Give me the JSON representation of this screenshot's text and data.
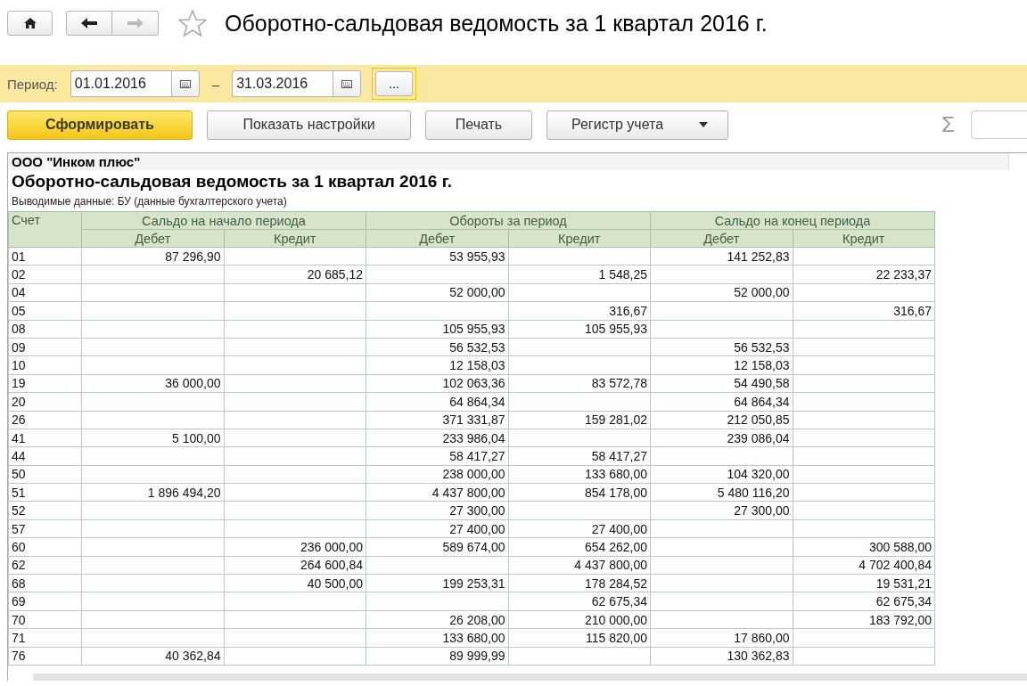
{
  "nav": {
    "back_disabled": false,
    "forward_disabled": true,
    "favorite": false
  },
  "window": {
    "title": "Оборотно-сальдовая ведомость за 1 квартал 2016 г."
  },
  "period": {
    "label": "Период:",
    "from": "01.01.2016",
    "separator": "–",
    "to": "31.03.2016",
    "more_button": "..."
  },
  "toolbar": {
    "buttons": [
      {
        "label": "Сформировать",
        "kind": "primary"
      },
      {
        "label": "Показать настройки",
        "kind": "plain"
      },
      {
        "label": "Печать",
        "kind": "plain"
      },
      {
        "label": "Регистр учета",
        "kind": "dropdown"
      }
    ],
    "sum_symbol": "Σ"
  },
  "report": {
    "organization": "ООО \"Инком плюс\"",
    "title": "Оборотно-сальдовая ведомость за 1 квартал 2016 г.",
    "subtitle": "Выводимые данные:  БУ (данные бухгалтерского учета)",
    "table": {
      "account_header": "Счет",
      "groups": [
        {
          "label": "Сальдо на начало периода",
          "debit": "Дебет",
          "credit": "Кредит"
        },
        {
          "label": "Обороты за период",
          "debit": "Дебет",
          "credit": "Кредит"
        },
        {
          "label": "Сальдо на конец периода",
          "debit": "Дебет",
          "credit": "Кредит"
        }
      ],
      "rows": [
        [
          "01",
          "87 296,90",
          null,
          "53 955,93",
          null,
          "141 252,83",
          null
        ],
        [
          "02",
          null,
          "20 685,12",
          null,
          "1 548,25",
          null,
          "22 233,37"
        ],
        [
          "04",
          null,
          null,
          "52 000,00",
          null,
          "52 000,00",
          null
        ],
        [
          "05",
          null,
          null,
          null,
          "316,67",
          null,
          "316,67"
        ],
        [
          "08",
          null,
          null,
          "105 955,93",
          "105 955,93",
          null,
          null
        ],
        [
          "09",
          null,
          null,
          "56 532,53",
          null,
          "56 532,53",
          null
        ],
        [
          "10",
          null,
          null,
          "12 158,03",
          null,
          "12 158,03",
          null
        ],
        [
          "19",
          "36 000,00",
          null,
          "102 063,36",
          "83 572,78",
          "54 490,58",
          null
        ],
        [
          "20",
          null,
          null,
          "64 864,34",
          null,
          "64 864,34",
          null
        ],
        [
          "26",
          null,
          null,
          "371 331,87",
          "159 281,02",
          "212 050,85",
          null
        ],
        [
          "41",
          "5 100,00",
          null,
          "233 986,04",
          null,
          "239 086,04",
          null
        ],
        [
          "44",
          null,
          null,
          "58 417,27",
          "58 417,27",
          null,
          null
        ],
        [
          "50",
          null,
          null,
          "238 000,00",
          "133 680,00",
          "104 320,00",
          null
        ],
        [
          "51",
          "1 896 494,20",
          null,
          "4 437 800,00",
          "854 178,00",
          "5 480 116,20",
          null
        ],
        [
          "52",
          null,
          null,
          "27 300,00",
          null,
          "27 300,00",
          null
        ],
        [
          "57",
          null,
          null,
          "27 400,00",
          "27 400,00",
          null,
          null
        ],
        [
          "60",
          null,
          "236 000,00",
          "589 674,00",
          "654 262,00",
          null,
          "300 588,00"
        ],
        [
          "62",
          null,
          "264 600,84",
          null,
          "4 437 800,00",
          null,
          "4 702 400,84"
        ],
        [
          "68",
          null,
          "40 500,00",
          "199 253,31",
          "178 284,52",
          null,
          "19 531,21"
        ],
        [
          "69",
          null,
          null,
          null,
          "62 675,34",
          null,
          "62 675,34"
        ],
        [
          "70",
          null,
          null,
          "26 208,00",
          "210 000,00",
          null,
          "183 792,00"
        ],
        [
          "71",
          null,
          null,
          "133 680,00",
          "115 820,00",
          "17 860,00",
          null
        ],
        [
          "76",
          "40 362,84",
          null,
          "89 999,99",
          null,
          "130 362,83",
          null
        ]
      ]
    }
  }
}
